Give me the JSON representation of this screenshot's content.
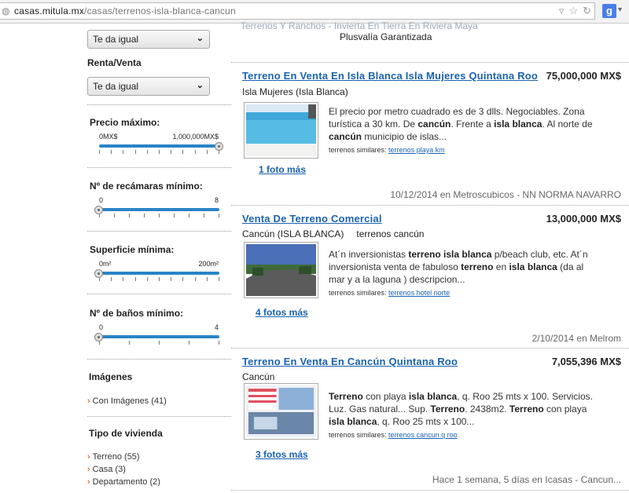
{
  "browser": {
    "url_domain": "casas.mitula.mx",
    "url_path": "/casas/terrenos-isla-blanca-cancun",
    "search_engine_letter": "g"
  },
  "sidebar": {
    "select_any_1": "Te da igual",
    "renta_venta_title": "Renta/Venta",
    "select_any_2": "Te da igual",
    "precio": {
      "title": "Precio máximo:",
      "min": "0MX$",
      "max": "1,000,000MX$",
      "value_fraction": 1.0
    },
    "recamaras": {
      "title": "Nº de recámaras mínimo:",
      "min": "0",
      "max": "8",
      "value_fraction": 0.0
    },
    "superficie": {
      "title": "Superficie mínima:",
      "min": "0m²",
      "max": "200m²",
      "value_fraction": 0.0
    },
    "banos": {
      "title": "Nº de baños mínimo:",
      "min": "0",
      "max": "4",
      "value_fraction": 0.0
    },
    "imagenes": {
      "title": "Imágenes",
      "items": [
        {
          "label": "Con Imágenes",
          "count": "(41)"
        }
      ]
    },
    "tipo": {
      "title": "Tipo de vivienda",
      "items": [
        {
          "label": "Terreno",
          "count": "(55)"
        },
        {
          "label": "Casa",
          "count": "(3)"
        },
        {
          "label": "Departamento",
          "count": "(2)"
        }
      ]
    }
  },
  "top_partial": {
    "title_fragment": "Terrenos Y Ranchos - Invierta En Tierra En Riviera Maya",
    "subtitle": "Plusvalía Garantizada"
  },
  "listings": [
    {
      "title": "Terreno En Venta En Isla Blanca Isla Mujeres Quintana Roo",
      "price": "75,000,000 MX$",
      "location": "Isla Mujeres (Isla Blanca)",
      "location_extra": "",
      "description_html": "El precio por metro cuadrado es de 3 dlls. Negociables. Zona turística a 30 km. De <b>cancún</b>. Frente a <b>isla blanca</b>. Al norte de <b>cancún</b> municipio de islas...",
      "similar_label": "terrenos similares:",
      "similar_link": "terrenos playa km",
      "more_photos": "1 foto más",
      "meta": "10/12/2014 en Metroscubicos - NN NORMA NAVARRO"
    },
    {
      "title": "Venta De Terreno Comercial",
      "price": "13,000,000 MX$",
      "location": "Cancún (ISLA BLANCA)",
      "location_extra": "terrenos cancún",
      "description_html": "At´n inversionistas <b>terreno isla blanca</b> p/beach club, etc. At´n inversionista venta de fabuloso <b>terreno</b> en <b>isla blanca</b> (da al mar y a la laguna ) descripcion...",
      "similar_label": "terrenos similares:",
      "similar_link": "terrenos hotel norte",
      "more_photos": "4 fotos más",
      "meta": "2/10/2014 en Melrom"
    },
    {
      "title": "Terreno En Venta En Cancún Quintana Roo",
      "price": "7,055,396 MX$",
      "location": "Cancún",
      "location_extra": "",
      "description_html": "<b>Terreno</b> con playa <b>isla blanca</b>, q. Roo 25 mts x 100. Servicios. Luz. Gas natural... Sup. <b>Terreno</b>. 2438m2. <b>Terreno</b> con playa <b>isla blanca</b>, q. Roo 25 mts x 100...",
      "similar_label": "terrenos similares:",
      "similar_link": "terrenos cancun q roo",
      "more_photos": "3 fotos más",
      "meta": "Hace 1 semana, 5 días en Icasas - Cancun..."
    }
  ],
  "colors": {
    "link": "#1a62b0",
    "slider": "#2a84c6",
    "arrow": "#d04a00"
  },
  "icons": {
    "page": "globe-icon",
    "dropdown": "chevron-down-icon",
    "bookmark": "star-icon",
    "reload": "reload-icon"
  }
}
